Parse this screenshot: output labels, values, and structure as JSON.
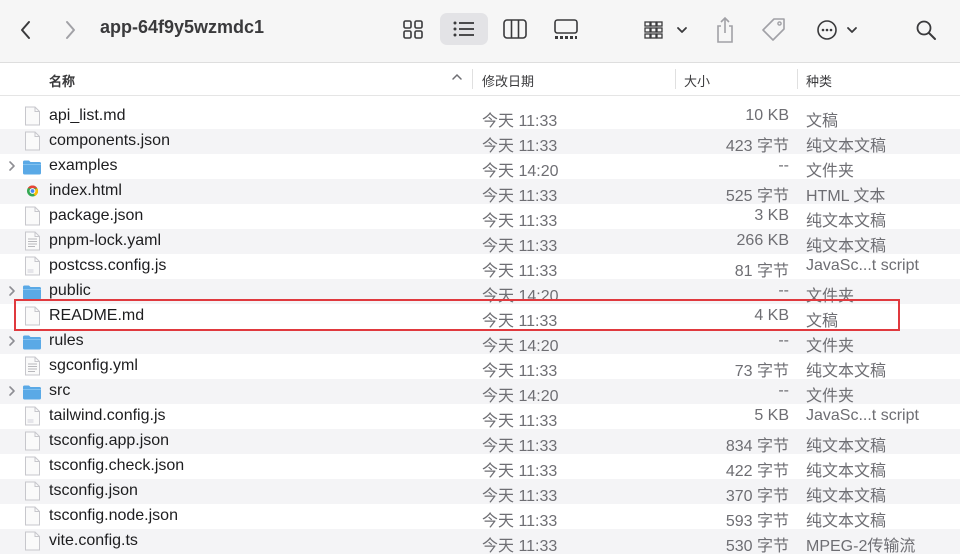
{
  "window": {
    "title": "app-64f9y5wzmdc1"
  },
  "toolbar": {
    "back_icon": "chevron-left-icon",
    "forward_icon": "chevron-right-icon",
    "views": [
      "icon-view",
      "list-view",
      "column-view",
      "gallery-view"
    ],
    "active_view": "list-view",
    "group_icon": "group-grid-icon",
    "share_icon": "share-icon",
    "tag_icon": "tag-icon",
    "more_icon": "ellipsis-circle-icon",
    "search_icon": "search-icon"
  },
  "columns": {
    "name": "名称",
    "date": "修改日期",
    "size": "大小",
    "kind": "种类"
  },
  "colors": {
    "highlight": "#e0393e",
    "folder": "#5aa9e6",
    "alt_row": "#f4f4f6"
  },
  "files": [
    {
      "name": "api_list.md",
      "date": "今天 11:33",
      "size": "10 KB",
      "kind": "文稿",
      "type": "doc",
      "expandable": false
    },
    {
      "name": "components.json",
      "date": "今天 11:33",
      "size": "423 字节",
      "kind": "纯文本文稿",
      "type": "doc",
      "expandable": false
    },
    {
      "name": "examples",
      "date": "今天 14:20",
      "size": "--",
      "kind": "文件夹",
      "type": "folder",
      "expandable": true
    },
    {
      "name": "index.html",
      "date": "今天 11:33",
      "size": "525 字节",
      "kind": "HTML 文本",
      "type": "html",
      "expandable": false
    },
    {
      "name": "package.json",
      "date": "今天 11:33",
      "size": "3 KB",
      "kind": "纯文本文稿",
      "type": "doc",
      "expandable": false
    },
    {
      "name": "pnpm-lock.yaml",
      "date": "今天 11:33",
      "size": "266 KB",
      "kind": "纯文本文稿",
      "type": "lines",
      "expandable": false
    },
    {
      "name": "postcss.config.js",
      "date": "今天 11:33",
      "size": "81 字节",
      "kind": "JavaSc...t script",
      "type": "js",
      "expandable": false
    },
    {
      "name": "public",
      "date": "今天 14:20",
      "size": "--",
      "kind": "文件夹",
      "type": "folder",
      "expandable": true
    },
    {
      "name": "README.md",
      "date": "今天 11:33",
      "size": "4 KB",
      "kind": "文稿",
      "type": "doc",
      "expandable": false
    },
    {
      "name": "rules",
      "date": "今天 14:20",
      "size": "--",
      "kind": "文件夹",
      "type": "folder",
      "expandable": true
    },
    {
      "name": "sgconfig.yml",
      "date": "今天 11:33",
      "size": "73 字节",
      "kind": "纯文本文稿",
      "type": "lines",
      "expandable": false
    },
    {
      "name": "src",
      "date": "今天 14:20",
      "size": "--",
      "kind": "文件夹",
      "type": "folder",
      "expandable": true
    },
    {
      "name": "tailwind.config.js",
      "date": "今天 11:33",
      "size": "5 KB",
      "kind": "JavaSc...t script",
      "type": "js",
      "expandable": false
    },
    {
      "name": "tsconfig.app.json",
      "date": "今天 11:33",
      "size": "834 字节",
      "kind": "纯文本文稿",
      "type": "doc",
      "expandable": false
    },
    {
      "name": "tsconfig.check.json",
      "date": "今天 11:33",
      "size": "422 字节",
      "kind": "纯文本文稿",
      "type": "doc",
      "expandable": false
    },
    {
      "name": "tsconfig.json",
      "date": "今天 11:33",
      "size": "370 字节",
      "kind": "纯文本文稿",
      "type": "doc",
      "expandable": false
    },
    {
      "name": "tsconfig.node.json",
      "date": "今天 11:33",
      "size": "593 字节",
      "kind": "纯文本文稿",
      "type": "doc",
      "expandable": false
    },
    {
      "name": "vite.config.ts",
      "date": "今天 11:33",
      "size": "530 字节",
      "kind": "MPEG-2传输流",
      "type": "doc",
      "expandable": false
    }
  ]
}
